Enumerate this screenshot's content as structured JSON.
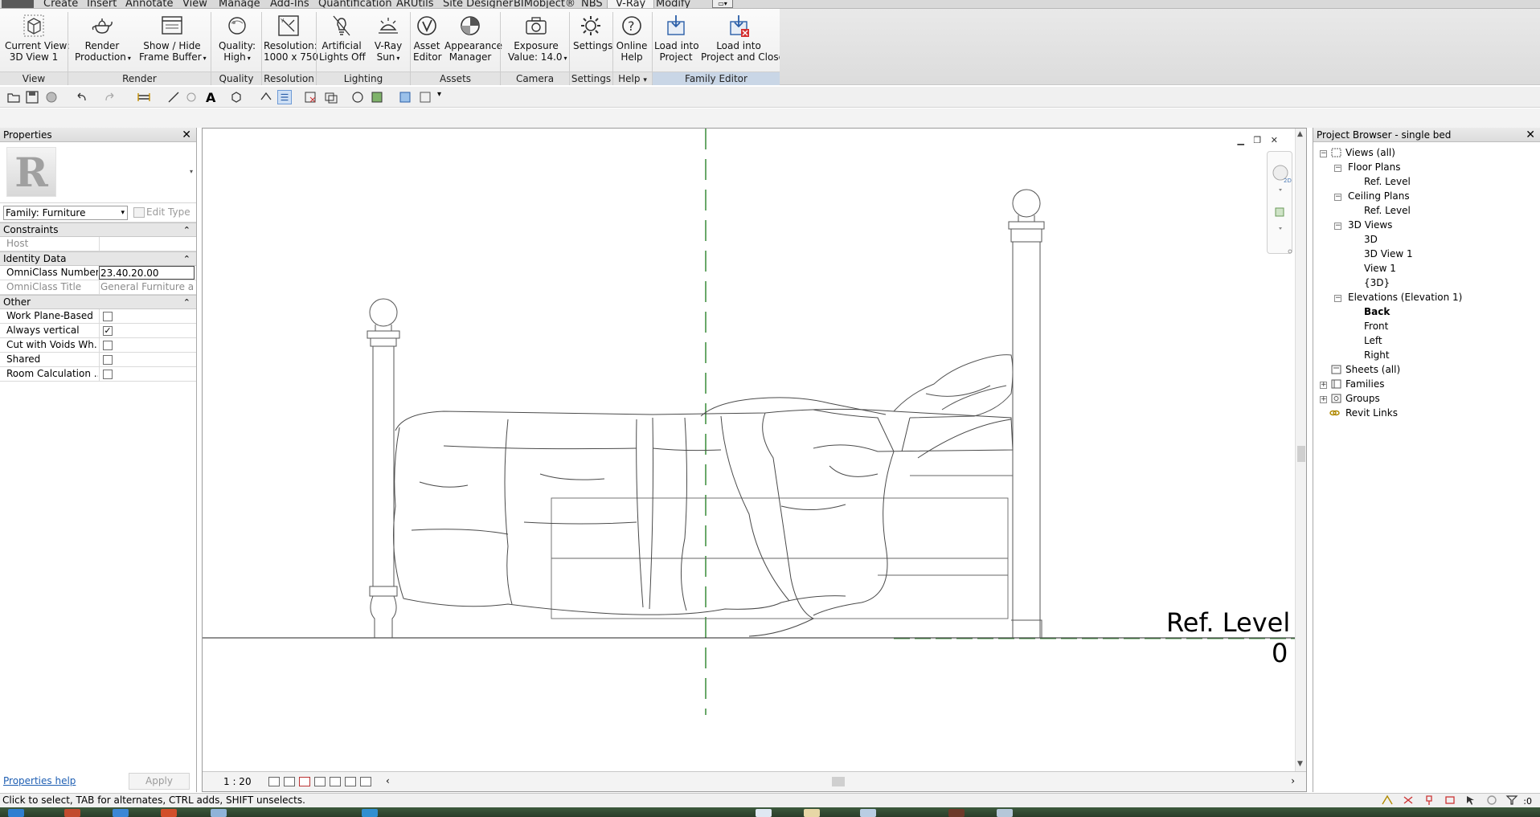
{
  "ribbon": {
    "tabs": [
      "Create",
      "Insert",
      "Annotate",
      "View",
      "Manage",
      "Add-Ins",
      "Quantification",
      "ARUtils",
      "Site Designer",
      "BIMobject®",
      "NBS",
      "V-Ray",
      "Modify"
    ],
    "active_tab": "V-Ray",
    "buttons": {
      "current_view": [
        "Current View:",
        "3D View 1"
      ],
      "render": [
        "Render",
        "Production"
      ],
      "frame_buffer": [
        "Show / Hide",
        "Frame Buffer"
      ],
      "quality": [
        "Quality:",
        "High"
      ],
      "resolution": [
        "Resolution:",
        "1000 x 750"
      ],
      "artificial_lights": [
        "Artificial",
        "Lights Off"
      ],
      "vray_sun": [
        "V-Ray",
        "Sun"
      ],
      "asset_editor": [
        "Asset",
        "Editor"
      ],
      "appearance_manager": [
        "Appearance",
        "Manager"
      ],
      "exposure": [
        "Exposure",
        "Value: 14.0"
      ],
      "settings": [
        "Settings"
      ],
      "online_help": [
        "Online",
        "Help"
      ],
      "load_into_project": [
        "Load into",
        "Project"
      ],
      "load_into_project_close": [
        "Load into",
        "Project and Close"
      ]
    },
    "groups": {
      "view": "View",
      "render": "Render",
      "quality": "Quality",
      "resolution": "Resolution",
      "lighting": "Lighting",
      "assets": "Assets",
      "camera": "Camera",
      "settings": "Settings",
      "help": "Help",
      "family_editor": "Family Editor"
    }
  },
  "properties": {
    "title": "Properties",
    "family_selector": "Family: Furniture",
    "edit_type": "Edit Type",
    "sections": {
      "constraints": "Constraints",
      "identity": "Identity Data",
      "other": "Other"
    },
    "rows": {
      "host": {
        "label": "Host",
        "value": ""
      },
      "omniclass_number": {
        "label": "OmniClass Number",
        "value": "23.40.20.00"
      },
      "omniclass_title": {
        "label": "OmniClass Title",
        "value": "General Furniture an..."
      },
      "work_plane_based": {
        "label": "Work Plane-Based",
        "checked": false
      },
      "always_vertical": {
        "label": "Always vertical",
        "checked": true
      },
      "cut_with_voids": {
        "label": "Cut with Voids Wh...",
        "checked": false
      },
      "shared": {
        "label": "Shared",
        "checked": false
      },
      "room_calculation": {
        "label": "Room Calculation ...",
        "checked": false
      }
    },
    "help_link": "Properties help",
    "apply": "Apply"
  },
  "view": {
    "level_name": "Ref. Level",
    "level_elevation": "0",
    "scale": "1 : 20"
  },
  "browser": {
    "title": "Project Browser - single bed",
    "nodes": {
      "views_all": "Views (all)",
      "floor_plans": "Floor Plans",
      "fp_ref_level": "Ref. Level",
      "ceiling_plans": "Ceiling Plans",
      "cp_ref_level": "Ref. Level",
      "views_3d": "3D Views",
      "v3d": "3D",
      "v3d_view1": "3D View 1",
      "v3d_view1b": "View 1",
      "v3d_brace": "{3D}",
      "elevations": "Elevations (Elevation 1)",
      "el_back": "Back",
      "el_front": "Front",
      "el_left": "Left",
      "el_right": "Right",
      "sheets": "Sheets (all)",
      "families": "Families",
      "groups": "Groups",
      "revit_links": "Revit Links"
    }
  },
  "status": {
    "text": "Click to select, TAB for alternates, CTRL adds, SHIFT unselects.",
    "filter_count": ":0"
  },
  "colors": {
    "active_tab_bg": "#f4f4f4",
    "family_editor_group": "#c9d6e6",
    "level_line_green": "#1a7a1a",
    "link_blue": "#1f5fb3"
  }
}
